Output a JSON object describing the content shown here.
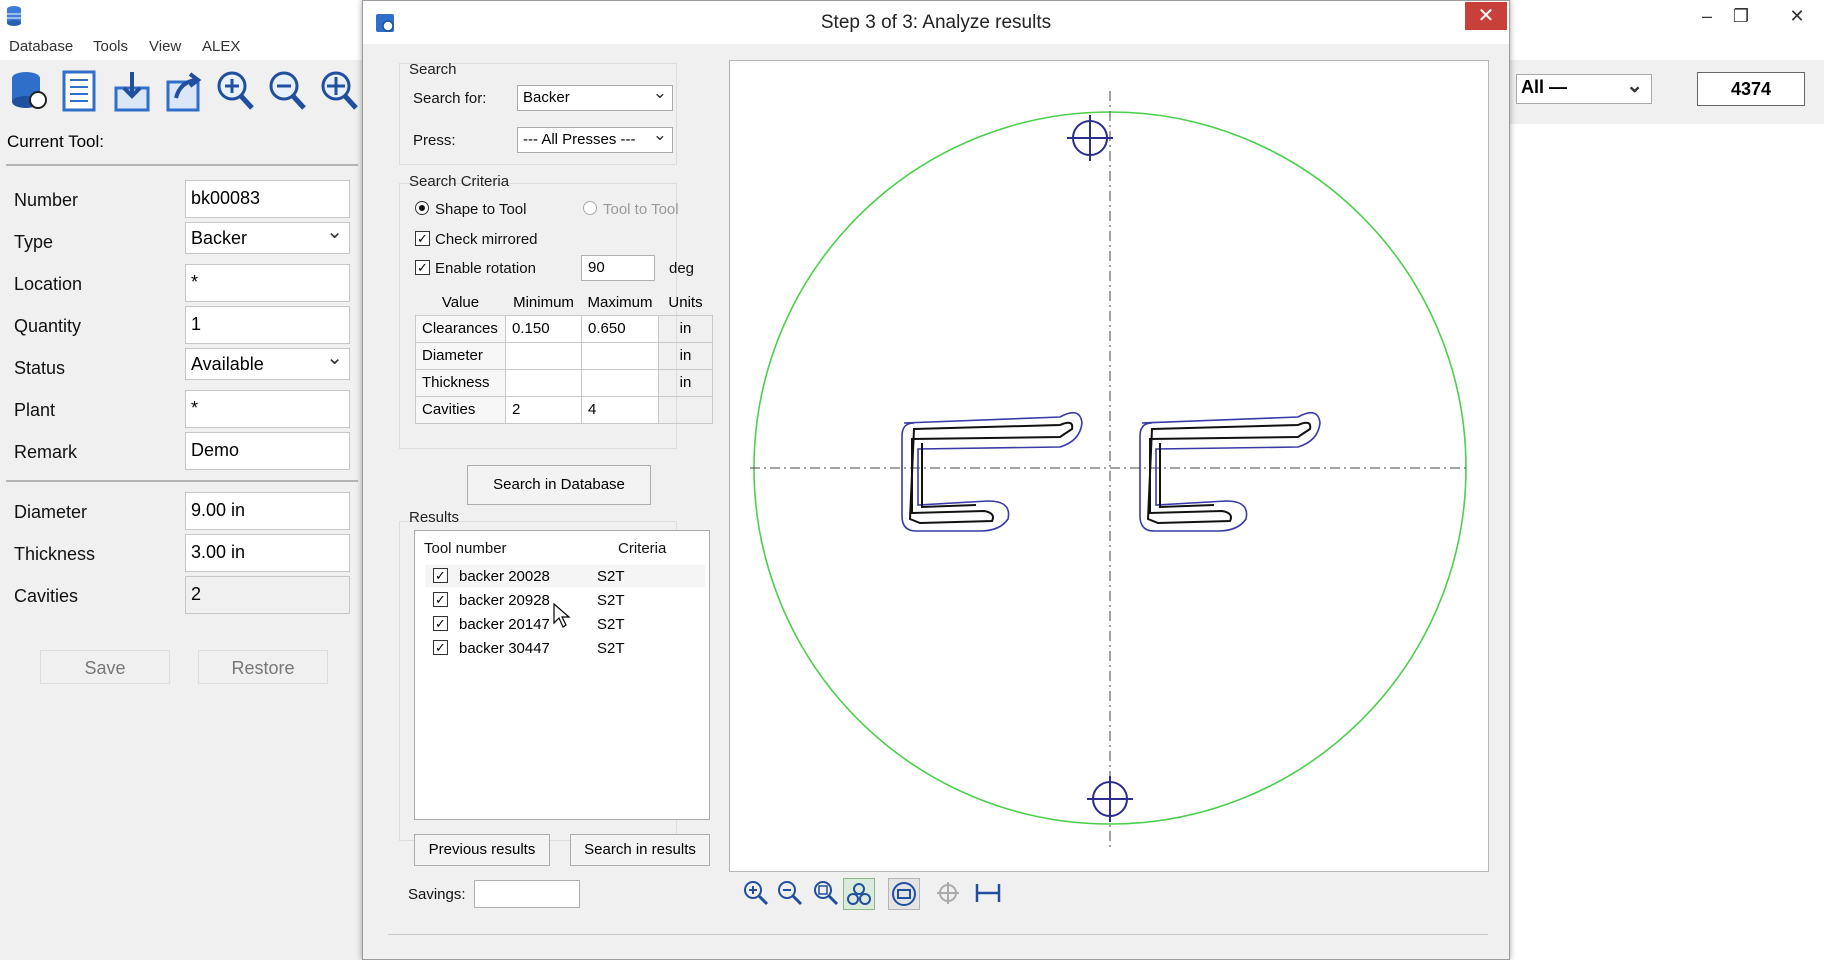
{
  "app": {
    "menu": [
      "Database",
      "Tools",
      "View",
      "ALEX"
    ],
    "filter_select": "All —",
    "number_box": "4374"
  },
  "left_panel": {
    "heading": "Current Tool:",
    "fields": [
      {
        "label": "Number",
        "value": "bk00083",
        "kind": "text"
      },
      {
        "label": "Type",
        "value": "Backer",
        "kind": "select"
      },
      {
        "label": "Location",
        "value": "*",
        "kind": "text"
      },
      {
        "label": "Quantity",
        "value": "1",
        "kind": "text"
      },
      {
        "label": "Status",
        "value": "Available",
        "kind": "select"
      },
      {
        "label": "Plant",
        "value": "*",
        "kind": "text"
      },
      {
        "label": "Remark",
        "value": "Demo",
        "kind": "text"
      }
    ],
    "dims": [
      {
        "label": "Diameter",
        "value": "9.00 in"
      },
      {
        "label": "Thickness",
        "value": "3.00 in"
      },
      {
        "label": "Cavities",
        "value": "2"
      }
    ],
    "save_label": "Save",
    "restore_label": "Restore"
  },
  "dialog": {
    "title": "Step 3 of 3: Analyze results",
    "close_glyph": "✕",
    "search": {
      "group_label": "Search",
      "search_for_label": "Search for:",
      "search_for_value": "Backer",
      "press_label": "Press:",
      "press_value": "--- All Presses ---"
    },
    "criteria": {
      "group_label": "Search Criteria",
      "shape_to_tool": "Shape to Tool",
      "tool_to_tool": "Tool to Tool",
      "check_mirrored": "Check mirrored",
      "enable_rotation": "Enable rotation",
      "rotation_value": "90",
      "rotation_unit": "deg",
      "headers": [
        "Value",
        "Minimum",
        "Maximum",
        "Units"
      ],
      "rows": [
        {
          "name": "Clearances",
          "min": "0.150",
          "max": "0.650",
          "unit": "in"
        },
        {
          "name": "Diameter",
          "min": "",
          "max": "",
          "unit": "in"
        },
        {
          "name": "Thickness",
          "min": "",
          "max": "",
          "unit": "in"
        },
        {
          "name": "Cavities",
          "min": "2",
          "max": "4",
          "unit": ""
        }
      ]
    },
    "search_db_label": "Search in Database",
    "results": {
      "group_label": "Results",
      "col_tool": "Tool number",
      "col_criteria": "Criteria",
      "rows": [
        {
          "tool": "backer 20028",
          "criteria": "S2T"
        },
        {
          "tool": "backer 20928",
          "criteria": "S2T"
        },
        {
          "tool": "backer 20147",
          "criteria": "S2T"
        },
        {
          "tool": "backer 30447",
          "criteria": "S2T"
        }
      ]
    },
    "previous_results_label": "Previous results",
    "search_in_results_label": "Search in results",
    "savings_label": "Savings:",
    "savings_value": "",
    "colors": {
      "circle": "#4cd04c",
      "shape": "#3a3aa8",
      "crosshair": "#2c2c8c"
    }
  }
}
